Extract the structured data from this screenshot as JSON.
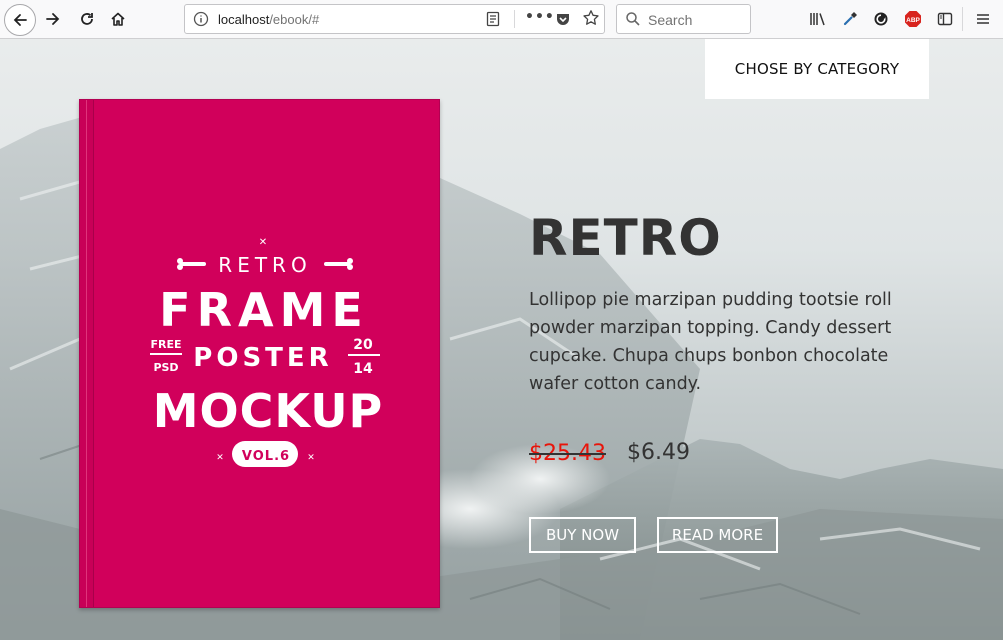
{
  "browser": {
    "url_host": "localhost",
    "url_path": "/ebook/#",
    "search_placeholder": "Search",
    "abp_label": "ABP"
  },
  "page": {
    "category_button": "CHOSE BY CATEGORY",
    "book_cover": {
      "line_retro": "RETRO",
      "line_frame": "FRAME",
      "line_free": "FREE",
      "line_psd": "PSD",
      "line_poster": "POSTER",
      "line_year_top": "20",
      "line_year_bottom": "14",
      "line_mockup": "MOCKUP",
      "line_vol": "VOL.6"
    },
    "title": "RETRO",
    "description": "Lollipop pie marzipan pudding tootsie roll powder marzipan topping. Candy dessert cupcake. Chupa chups bonbon chocolate wafer cotton candy.",
    "old_price": "$25.43",
    "new_price": "$6.49",
    "buy_label": "BUY NOW",
    "read_label": "READ MORE"
  },
  "colors": {
    "book_cover": "#d1005b",
    "old_price": "#e8140a",
    "text_dark": "#333333"
  }
}
